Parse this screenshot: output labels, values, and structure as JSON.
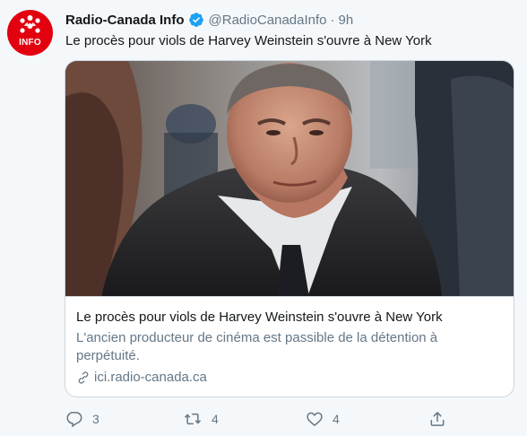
{
  "account": {
    "name": "Radio-Canada Info",
    "handle": "@RadioCanadaInfo",
    "separator": "·",
    "time": "9h",
    "avatar_text": "INFO",
    "verified_icon": "verified-badge-icon"
  },
  "tweet": {
    "text": "Le procès pour viols de Harvey Weinstein s'ouvre à New York"
  },
  "card": {
    "title": "Le procès pour viols de Harvey Weinstein s'ouvre à New York",
    "description": "L'ancien producteur de cinéma est passible de la détention à perpétuité.",
    "domain": "ici.radio-canada.ca",
    "link_icon": "link-icon"
  },
  "actions": {
    "reply_count": "3",
    "retweet_count": "4",
    "like_count": "4"
  },
  "colors": {
    "background": "#f5f8fa",
    "brand_red": "#e3000f",
    "verified_blue": "#1da1f2",
    "secondary_text": "#657786",
    "border": "#ccd6dd"
  }
}
